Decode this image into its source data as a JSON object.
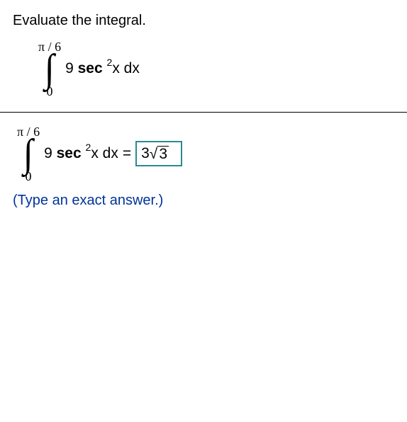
{
  "question": "Evaluate the integral.",
  "integral": {
    "upper": "π / 6",
    "lower": "0",
    "coeff": "9",
    "funcName": "sec",
    "exponent": "2",
    "variable": "x",
    "dx": "dx"
  },
  "equalsSign": "=",
  "answer": {
    "coeff": "3",
    "radicand": "3"
  },
  "hint": "(Type an exact answer.)",
  "chart_data": {
    "type": "table",
    "title": "Definite integral evaluation",
    "expression": "∫ from 0 to π/6 of 9 sec^2(x) dx",
    "lower_limit": "0",
    "upper_limit": "π/6",
    "integrand": "9 sec^2(x)",
    "result": "3√3"
  }
}
